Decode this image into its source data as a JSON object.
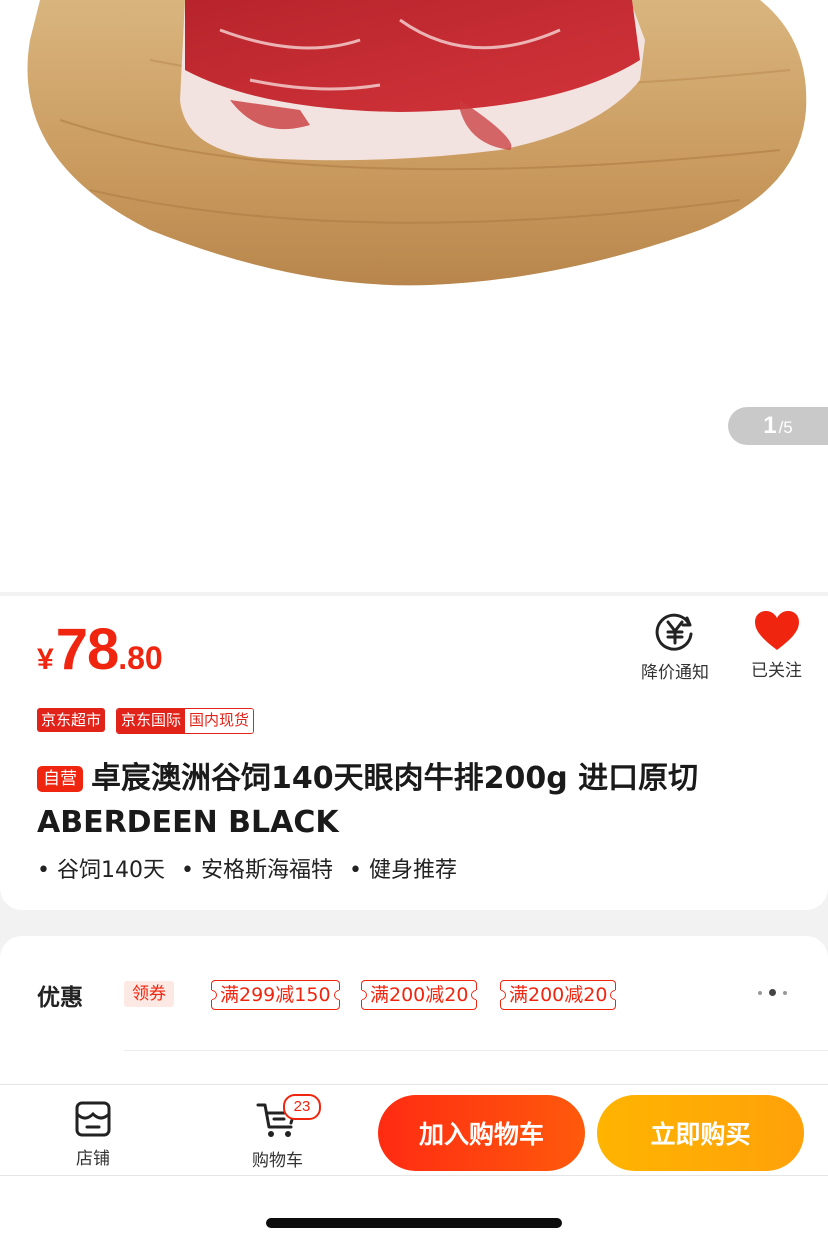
{
  "gallery": {
    "current": "1",
    "total": "/5"
  },
  "price": {
    "currency": "¥",
    "integer": "78",
    "decimal": ".80",
    "color": "#f0250f"
  },
  "actions": {
    "price_alert": "降价通知",
    "follow": "已关注"
  },
  "tags": {
    "supermarket": "京东超市",
    "international": "京东国际",
    "domestic_stock": "国内现货"
  },
  "product": {
    "self_operated": "自营",
    "title": "卓宸澳洲谷饲140天眼肉牛排200g 进口原切ABERDEEN BLACK",
    "bullets": [
      "谷饲140天",
      "安格斯海福特",
      "健身推荐"
    ]
  },
  "promotions": {
    "label": "优惠",
    "get_coupon": "领券",
    "coupons": [
      "满299减150",
      "满200减20",
      "满200减20"
    ]
  },
  "bottom_bar": {
    "store": "店铺",
    "cart": "购物车",
    "cart_count": "23",
    "add_to_cart": "加入购物车",
    "buy_now": "立即购买"
  },
  "colors": {
    "brand_red": "#e2231a",
    "buy_orange": "#ffab06",
    "cart_red": "#ff3a10"
  }
}
